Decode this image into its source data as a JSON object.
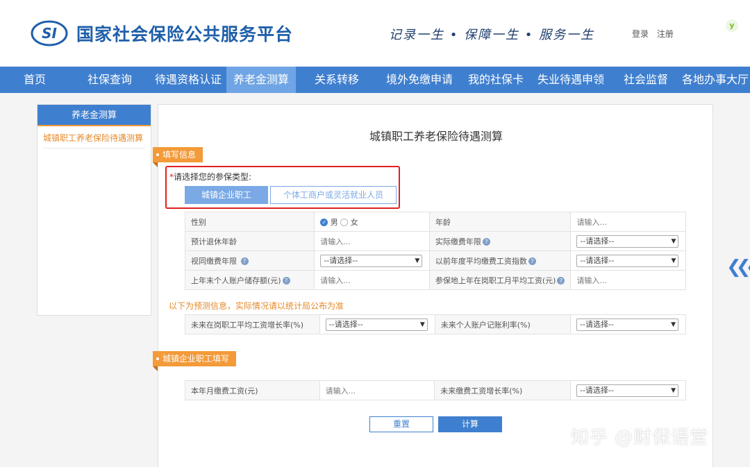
{
  "header": {
    "logo_text": "SI",
    "title": "国家社会保险公共服务平台",
    "slogan": "记录一生 • 保障一生 • 服务一生",
    "login": "登录",
    "register": "注册",
    "badge": "y"
  },
  "nav": {
    "items": [
      "首页",
      "社保查询",
      "待遇资格认证",
      "养老金测算",
      "关系转移",
      "境外免缴申请",
      "我的社保卡",
      "失业待遇申领",
      "社会监督",
      "各地办事大厅"
    ],
    "active_index": 3
  },
  "sidebar": {
    "heading": "养老金测算",
    "items": [
      "城镇职工养老保险待遇测算"
    ]
  },
  "main": {
    "title": "城镇职工养老保险待遇测算",
    "section_fill": "填写信息",
    "choose_star": "*",
    "choose_label": "请选择您的参保类型:",
    "type_options": [
      "城镇企业职工",
      "个体工商户或灵活就业人员"
    ],
    "selected_type_index": 0,
    "placeholder": "请输入...",
    "select_placeholder": "--请选择--",
    "gender": {
      "label": "性别",
      "male": "男",
      "female": "女",
      "selected": "男"
    },
    "age_label": "年龄",
    "retire_age_label": "预计退休年龄",
    "actual_years_label": "实际缴费年限",
    "deemed_years_label": "视同缴费年限",
    "past_index_label": "以前年度平均缴费工资指数",
    "account_balance_label": "上年末个人账户储存额(元)",
    "local_avg_wage_label": "参保地上年在岗职工月平均工资(元)",
    "forecast_note": "以下为预测信息，实际情况请以统计局公布为准",
    "future_wage_growth_label": "未来在岗职工平均工资增长率(%)",
    "future_interest_label": "未来个人账户记账利率(%)",
    "section_enterprise": "城镇企业职工填写",
    "month_wage_label": "本年月缴费工资(元)",
    "future_pay_growth_label": "未来缴费工资增长率(%)",
    "reset_button": "重置",
    "calc_button": "计算"
  },
  "watermark": "知乎 @财保语堂",
  "colors": {
    "brand_blue": "#3f7fcf",
    "accent_orange": "#f39a39",
    "highlight_red": "#e02020"
  }
}
